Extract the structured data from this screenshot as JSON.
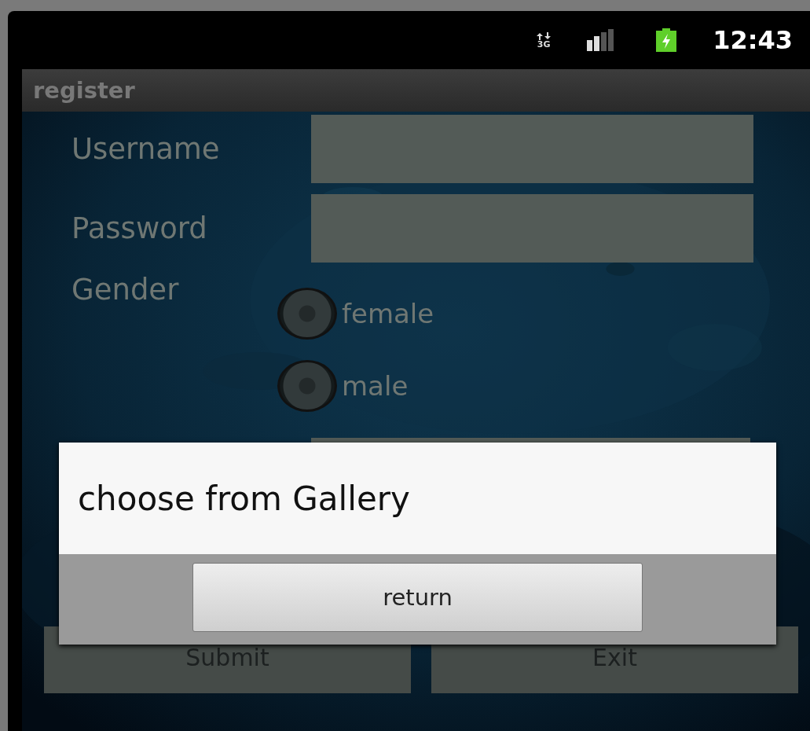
{
  "status_bar": {
    "network_type": "3G",
    "time": "12:43"
  },
  "title_bar": {
    "title": "register"
  },
  "form": {
    "fields": [
      {
        "label": "Username"
      },
      {
        "label": "Password"
      }
    ],
    "gender": {
      "label": "Gender",
      "options": [
        {
          "label": "female",
          "selected": false
        },
        {
          "label": "male",
          "selected": false
        }
      ]
    },
    "buttons": [
      "Submit",
      "Exit"
    ]
  },
  "dialog": {
    "message": "choose from Gallery",
    "button": "return"
  }
}
